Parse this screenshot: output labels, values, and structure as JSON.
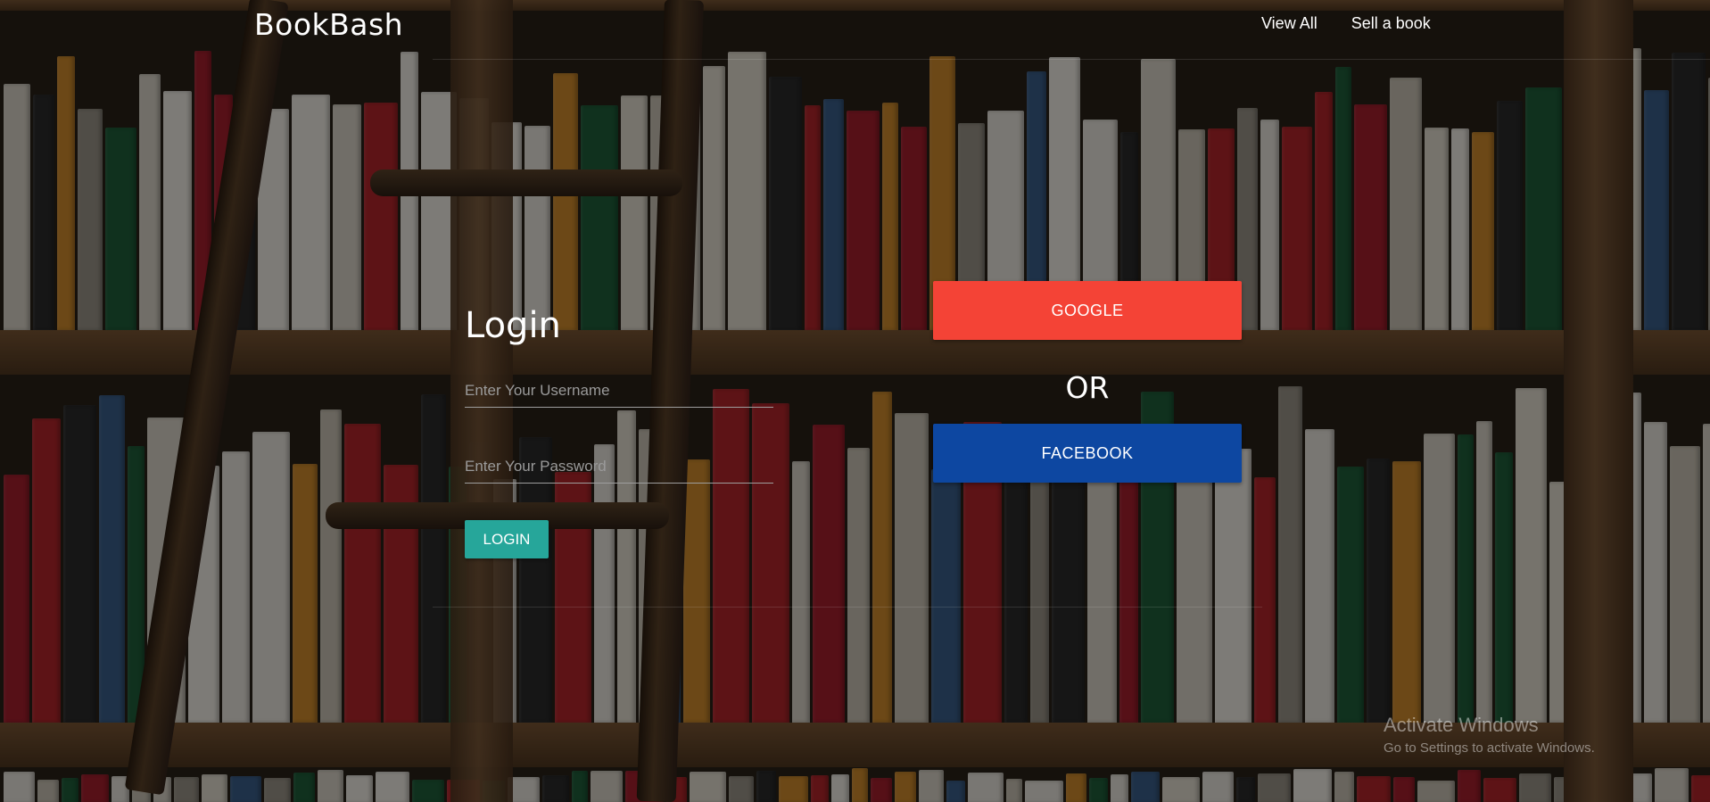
{
  "header": {
    "brand": "BookBash",
    "nav": [
      {
        "label": "View All"
      },
      {
        "label": "Sell a book"
      }
    ]
  },
  "login_form": {
    "title": "Login",
    "username_placeholder": "Enter Your Username",
    "username_value": "",
    "password_placeholder": "Enter Your Password",
    "password_value": "",
    "submit_label": "LOGIN"
  },
  "social": {
    "google_label": "GOOGLE",
    "or_label": "OR",
    "facebook_label": "FACEBOOK"
  },
  "watermark": {
    "line1": "Activate Windows",
    "line2": "Go to Settings to activate Windows."
  },
  "colors": {
    "login_button": "#26a69a",
    "google_button": "#f44336",
    "facebook_button": "#0d47a1",
    "shelf_wood": "#7a5634"
  }
}
